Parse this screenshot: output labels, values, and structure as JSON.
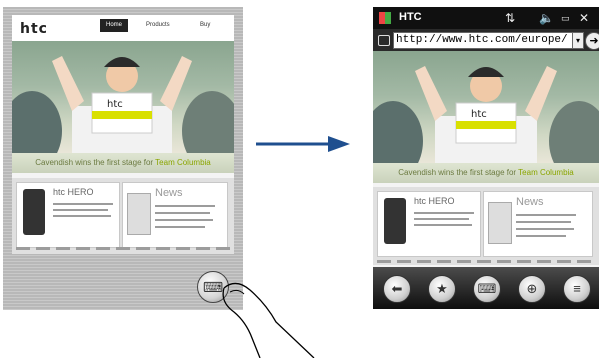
{
  "before": {
    "logo": "htc",
    "nav": [
      "Home",
      "Products",
      "Buy"
    ],
    "hero_caption_prefix": "Cavendish wins the first stage for ",
    "hero_caption_highlight": "Team Columbia",
    "promo_card_title": "htc HERO",
    "news_title": "News",
    "menu_icon": "keyboard-icon"
  },
  "after": {
    "status_title": "HTC",
    "url": "http://www.htc.com/europe/",
    "dropdown_glyph": "▾",
    "go_glyph": "➜",
    "close_glyph": "✕",
    "logo": "htc",
    "hero_caption_prefix": "Cavendish wins the first stage for ",
    "hero_caption_highlight": "Team Columbia",
    "promo_card_title": "htc HERO",
    "news_title": "News",
    "toolbar_icons": [
      "back-arrow-icon",
      "favorites-star-icon",
      "keyboard-icon",
      "zoom-icon",
      "menu-icon"
    ]
  },
  "colors": {
    "arrow": "#1f4f8f",
    "accent_green": "#8aa500"
  }
}
